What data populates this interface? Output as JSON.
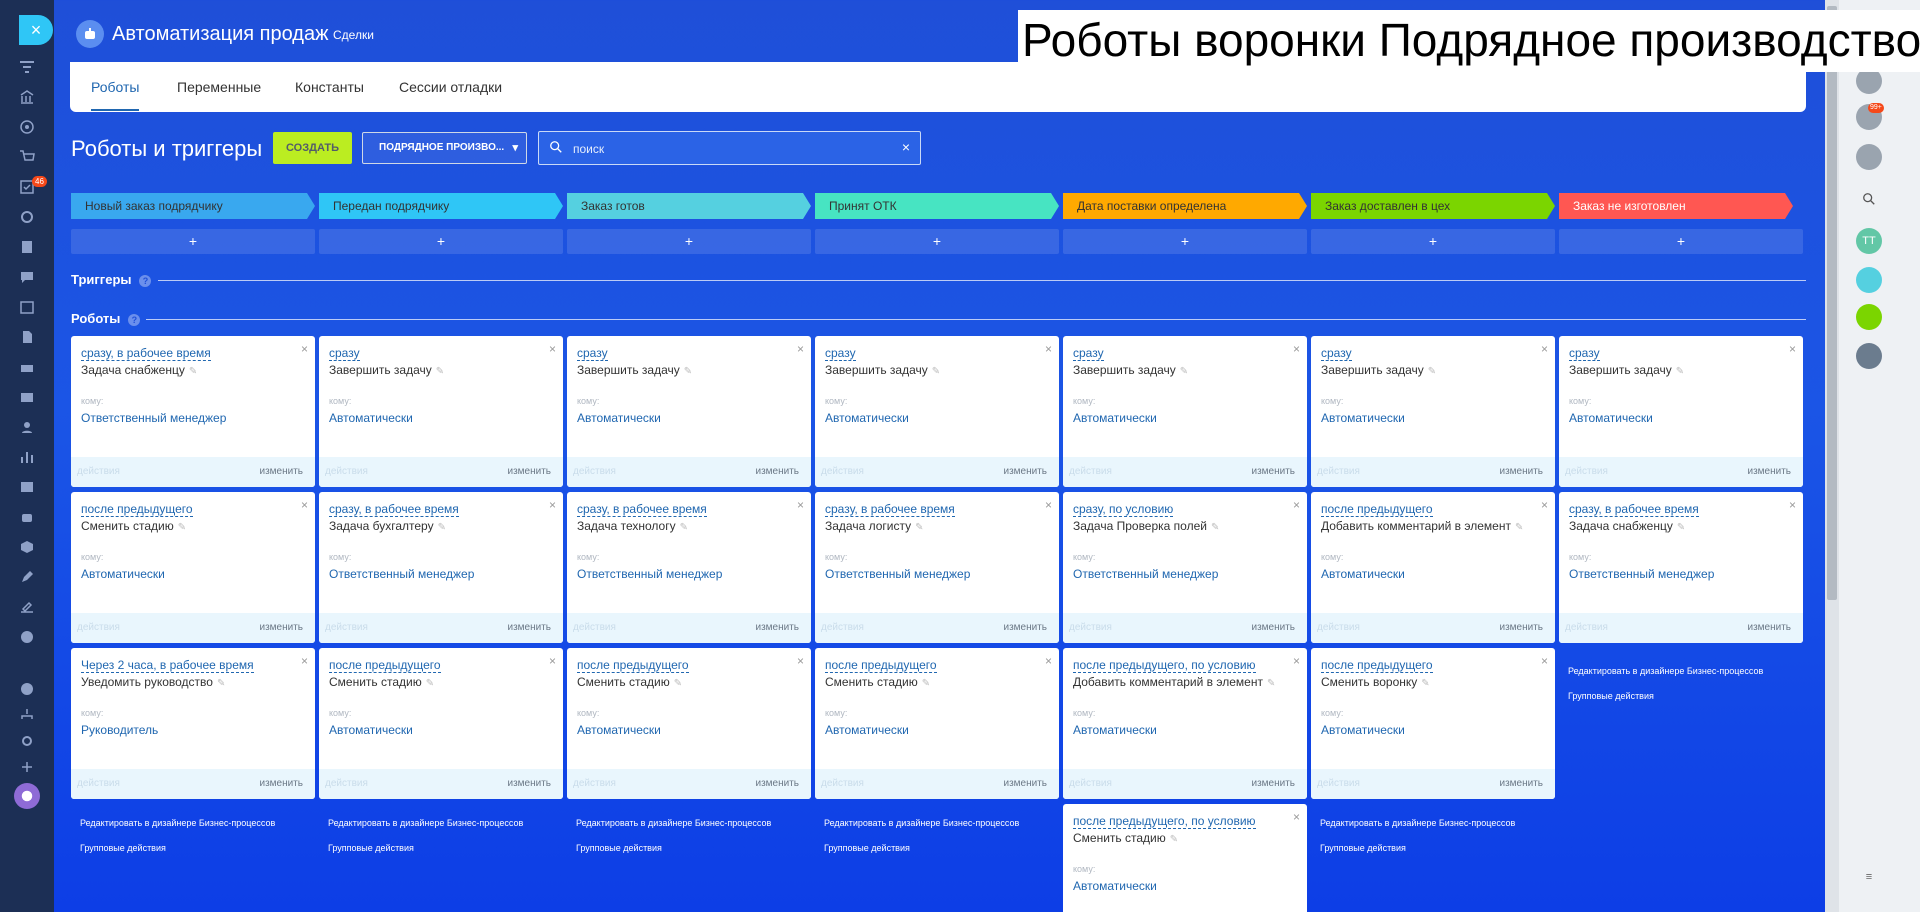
{
  "leftbar": {
    "close": "×",
    "badge": "46"
  },
  "header": {
    "title": "Автоматизация продаж",
    "deals": "Сделки",
    "banner": "Роботы воронки Подрядное производство"
  },
  "tabs": [
    "Роботы",
    "Переменные",
    "Константы",
    "Сессии отладки"
  ],
  "toolbar": {
    "heading": "Роботы и триггеры",
    "create": "СОЗДАТЬ",
    "funnel": "ПОДРЯДНОЕ ПРОИЗВО...",
    "search_placeholder": "поиск"
  },
  "stages": [
    {
      "name": "Новый заказ подрядчику",
      "color": "#39a8ef",
      "text": "#333333"
    },
    {
      "name": "Передан подрядчику",
      "color": "#2fc6f6",
      "text": "#333333"
    },
    {
      "name": "Заказ готов",
      "color": "#55d0e0",
      "text": "#333333"
    },
    {
      "name": "Принят ОТК",
      "color": "#47e4c2",
      "text": "#333333"
    },
    {
      "name": "Дата поставки определена",
      "color": "#ffa900",
      "text": "#333333"
    },
    {
      "name": "Заказ доставлен в цех",
      "color": "#7bd500",
      "text": "#333333"
    },
    {
      "name": "Заказ не изготовлен",
      "color": "#ff5752",
      "text": "#ffffff"
    }
  ],
  "add_label": "+",
  "sections": {
    "triggers": "Триггеры",
    "robots": "Роботы",
    "help": "?"
  },
  "card_labels": {
    "whom": "кому:",
    "actions": "действия",
    "edit": "изменить",
    "close": "×",
    "pen": "✎"
  },
  "columns": [
    {
      "robots": [
        {
          "cond": "сразу, в рабочее время",
          "name": "Задача снабженцу",
          "who": "Ответственный менеджер"
        },
        {
          "cond": "после предыдущего",
          "name": "Сменить стадию",
          "who": "Автоматически"
        },
        {
          "cond": "Через 2 часа, в рабочее время",
          "name": "Уведомить руководство",
          "who": "Руководитель"
        }
      ]
    },
    {
      "robots": [
        {
          "cond": "сразу",
          "name": "Завершить задачу",
          "who": "Автоматически"
        },
        {
          "cond": "сразу, в рабочее время",
          "name": "Задача бухгалтеру",
          "who": "Ответственный менеджер"
        },
        {
          "cond": "после предыдущего",
          "name": "Сменить стадию",
          "who": "Автоматически"
        }
      ]
    },
    {
      "robots": [
        {
          "cond": "сразу",
          "name": "Завершить задачу",
          "who": "Автоматически"
        },
        {
          "cond": "сразу, в рабочее время",
          "name": "Задача технологу",
          "who": "Ответственный менеджер"
        },
        {
          "cond": "после предыдущего",
          "name": "Сменить стадию",
          "who": "Автоматически"
        }
      ]
    },
    {
      "robots": [
        {
          "cond": "сразу",
          "name": "Завершить задачу",
          "who": "Автоматически"
        },
        {
          "cond": "сразу, в рабочее время",
          "name": "Задача логисту",
          "who": "Ответственный менеджер"
        },
        {
          "cond": "после предыдущего",
          "name": "Сменить стадию",
          "who": "Автоматически"
        }
      ]
    },
    {
      "robots": [
        {
          "cond": "сразу",
          "name": "Завершить задачу",
          "who": "Автоматически"
        },
        {
          "cond": "сразу, по условию",
          "name": "Задача Проверка полей",
          "who": "Ответственный менеджер"
        },
        {
          "cond": "после предыдущего, по условию",
          "name": "Добавить комментарий в элемент",
          "who": "Автоматически"
        },
        {
          "cond": "после предыдущего, по условию",
          "name": "Сменить стадию",
          "who": "Автоматически"
        }
      ]
    },
    {
      "robots": [
        {
          "cond": "сразу",
          "name": "Завершить задачу",
          "who": "Автоматически"
        },
        {
          "cond": "после предыдущего",
          "name": "Добавить комментарий в элемент",
          "who": "Автоматически"
        },
        {
          "cond": "после предыдущего",
          "name": "Сменить воронку",
          "who": "Автоматически"
        }
      ]
    },
    {
      "robots": [
        {
          "cond": "сразу",
          "name": "Завершить задачу",
          "who": "Автоматически"
        },
        {
          "cond": "сразу, в рабочее время",
          "name": "Задача снабженцу",
          "who": "Ответственный менеджер"
        }
      ]
    }
  ],
  "column_footer": {
    "designer": "Редактировать в дизайнере Бизнес-процессов",
    "group": "Групповые действия"
  },
  "rightpanel": {
    "notif_badge": "99+",
    "avatar": "ТТ"
  }
}
